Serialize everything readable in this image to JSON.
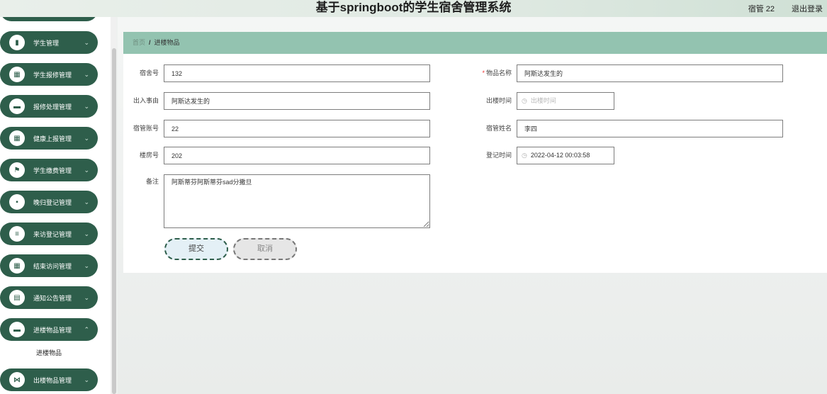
{
  "header": {
    "title": "基于springboot的学生宿舍管理系统",
    "user": "宿管 22",
    "logout": "退出登录"
  },
  "sidebar": {
    "items": [
      {
        "label": "学生管理",
        "icon": "bar-chart-icon",
        "glyph": "▮"
      },
      {
        "label": "学生报修管理",
        "icon": "grid-icon",
        "glyph": "▦"
      },
      {
        "label": "报修处理管理",
        "icon": "briefcase-icon",
        "glyph": "▬"
      },
      {
        "label": "健康上报管理",
        "icon": "grid-icon",
        "glyph": "▦"
      },
      {
        "label": "学生缴费管理",
        "icon": "flag-icon",
        "glyph": "⚑"
      },
      {
        "label": "晚归登记管理",
        "icon": "message-icon",
        "glyph": "▪"
      },
      {
        "label": "来访登记管理",
        "icon": "list-icon",
        "glyph": "≡"
      },
      {
        "label": "结束访问管理",
        "icon": "grid-icon",
        "glyph": "▦"
      },
      {
        "label": "通知公告管理",
        "icon": "document-icon",
        "glyph": "▤"
      },
      {
        "label": "进楼物品管理",
        "icon": "monitor-icon",
        "glyph": "▬"
      },
      {
        "label": "出楼物品管理",
        "icon": "bookmark-icon",
        "glyph": "⋈"
      }
    ],
    "submenu": "进楼物品"
  },
  "breadcrumb": {
    "home": "首页",
    "separator": "/",
    "current": "进楼物品"
  },
  "form": {
    "dorm_no": {
      "label": "宿舍号",
      "value": "132"
    },
    "item_name": {
      "label": "物品名称",
      "required_mark": "*",
      "value": "阿斯达发生的"
    },
    "reason": {
      "label": "出入事由",
      "value": "阿斯达发生的"
    },
    "exit_time": {
      "label": "出楼时间",
      "placeholder": "出楼时间"
    },
    "manager_account": {
      "label": "宿管账号",
      "value": "22"
    },
    "manager_name": {
      "label": "宿管姓名",
      "value": "李四"
    },
    "building_no": {
      "label": "楼房号",
      "value": "202"
    },
    "register_time": {
      "label": "登记时间",
      "value": "2022-04-12 00:03:58"
    },
    "remark": {
      "label": "备注",
      "value": "阿斯蒂芬阿斯蒂芬sad分撒旦"
    }
  },
  "buttons": {
    "submit": "提交",
    "cancel": "取消"
  }
}
